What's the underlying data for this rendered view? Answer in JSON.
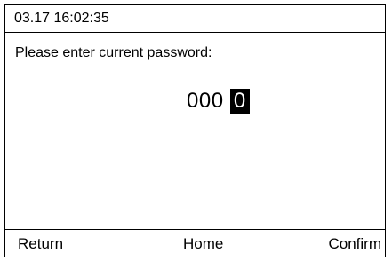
{
  "header": {
    "datetime": "03.17 16:02:35"
  },
  "main": {
    "prompt": "Please enter current password:",
    "password": {
      "entered_digits": "000",
      "active_digit": "0"
    }
  },
  "footer": {
    "return_label": "Return",
    "home_label": "Home",
    "confirm_label": "Confirm"
  },
  "colors": {
    "background": "#ffffff",
    "foreground": "#000000",
    "selection_background": "#000000",
    "selection_foreground": "#ffffff"
  }
}
